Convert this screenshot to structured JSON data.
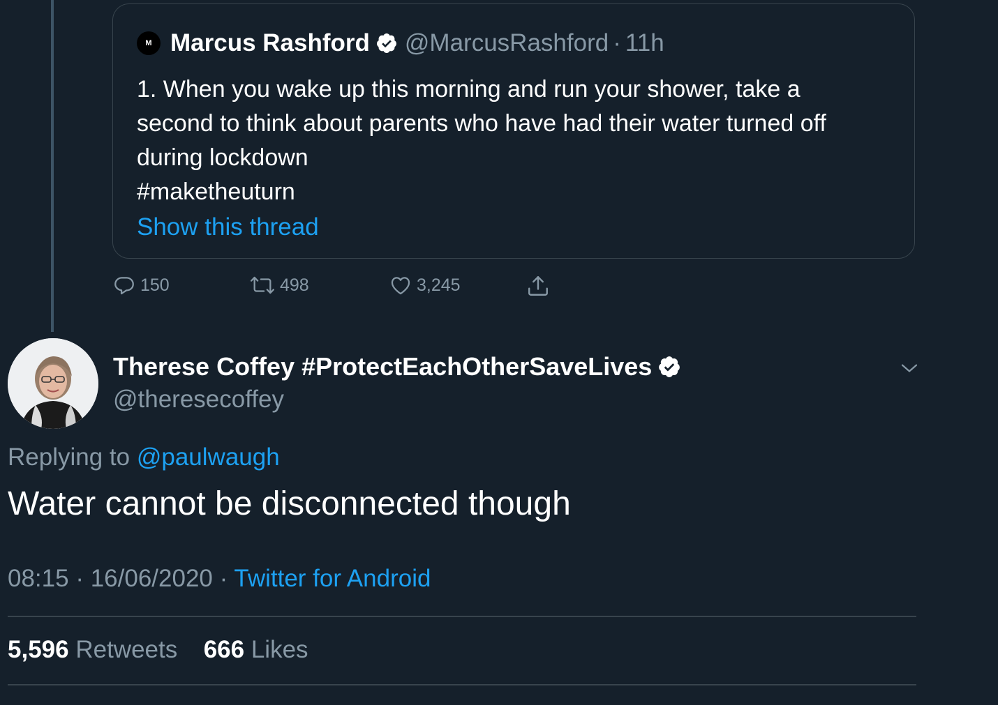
{
  "quoted_tweet": {
    "avatar_letters": "M",
    "name": "Marcus Rashford",
    "handle": "@MarcusRashford",
    "separator": "·",
    "time": "11h",
    "text_lines": [
      "1. When you wake up this morning and run your shower, take a",
      "second to think about parents who have had their water turned off",
      "during lockdown",
      "#maketheuturn"
    ],
    "show_thread": "Show this thread"
  },
  "actions": {
    "replies": "150",
    "retweets": "498",
    "likes": "3,245"
  },
  "tweet": {
    "name": "Therese Coffey #ProtectEachOtherSaveLives",
    "handle": "@theresecoffey",
    "replying_prefix": "Replying to",
    "replying_to": "@paulwaugh",
    "text": "Water cannot be disconnected though",
    "time": "08:15",
    "date": "16/06/2020",
    "separator": "·",
    "source": "Twitter for Android"
  },
  "stats": {
    "retweets_count": "5,596",
    "retweets_label": "Retweets",
    "likes_count": "666",
    "likes_label": "Likes"
  },
  "colors": {
    "background": "#15202b",
    "accent": "#1da1f2",
    "secondary_text": "#8899a6",
    "border": "#38444d"
  }
}
